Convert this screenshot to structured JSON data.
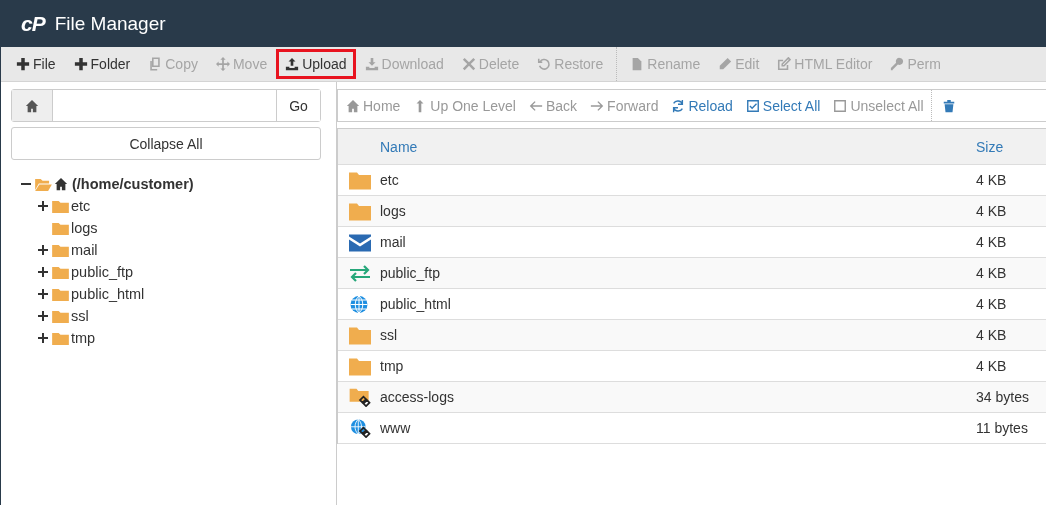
{
  "header": {
    "logo": "cP",
    "title": "File Manager"
  },
  "toolbar": [
    [
      {
        "label": "File",
        "kind": "plus",
        "disabled": false,
        "highlighted": false
      },
      {
        "label": "Folder",
        "kind": "plus",
        "disabled": false,
        "highlighted": false
      },
      {
        "label": "Copy",
        "kind": "copy",
        "disabled": true,
        "highlighted": false
      },
      {
        "label": "Move",
        "kind": "move",
        "disabled": true,
        "highlighted": false
      },
      {
        "label": "Upload",
        "kind": "upload",
        "disabled": false,
        "highlighted": true
      },
      {
        "label": "Download",
        "kind": "download",
        "disabled": true,
        "highlighted": false
      },
      {
        "label": "Delete",
        "kind": "delete",
        "disabled": true,
        "highlighted": false
      },
      {
        "label": "Restore",
        "kind": "restore",
        "disabled": true,
        "highlighted": false
      }
    ],
    [
      {
        "label": "Rename",
        "kind": "file",
        "disabled": true,
        "highlighted": false
      },
      {
        "label": "Edit",
        "kind": "pencil",
        "disabled": true,
        "highlighted": false
      },
      {
        "label": "HTML Editor",
        "kind": "htmledit",
        "disabled": true,
        "highlighted": false
      },
      {
        "label": "Perm",
        "kind": "key",
        "disabled": true,
        "highlighted": false
      }
    ]
  ],
  "path_bar": {
    "button": "Go"
  },
  "collapse_button": "Collapse All",
  "tree": {
    "label": "(/home/customer)",
    "expanded": true,
    "children": [
      {
        "label": "etc",
        "expandable": true
      },
      {
        "label": "logs",
        "expandable": false
      },
      {
        "label": "mail",
        "expandable": true
      },
      {
        "label": "public_ftp",
        "expandable": true
      },
      {
        "label": "public_html",
        "expandable": true
      },
      {
        "label": "ssl",
        "expandable": true
      },
      {
        "label": "tmp",
        "expandable": true
      }
    ]
  },
  "nav": [
    [
      {
        "label": "Home",
        "kind": "home",
        "disabled": true
      },
      {
        "label": "Up One Level",
        "kind": "up",
        "disabled": true
      },
      {
        "label": "Back",
        "kind": "back",
        "disabled": true
      },
      {
        "label": "Forward",
        "kind": "forward",
        "disabled": true
      },
      {
        "label": "Reload",
        "kind": "reload",
        "disabled": false
      },
      {
        "label": "Select All",
        "kind": "checked",
        "disabled": false
      },
      {
        "label": "Unselect All",
        "kind": "unchecked",
        "disabled": true
      }
    ],
    [
      {
        "kind": "trash",
        "disabled": false
      }
    ]
  ],
  "table": {
    "columns": [
      "Name",
      "Size"
    ],
    "rows": [
      {
        "kind": "folder",
        "name": "etc",
        "size": "4 KB"
      },
      {
        "kind": "folder",
        "name": "logs",
        "size": "4 KB"
      },
      {
        "kind": "mail",
        "name": "mail",
        "size": "4 KB"
      },
      {
        "kind": "ftp",
        "name": "public_ftp",
        "size": "4 KB"
      },
      {
        "kind": "globe",
        "name": "public_html",
        "size": "4 KB"
      },
      {
        "kind": "folder",
        "name": "ssl",
        "size": "4 KB"
      },
      {
        "kind": "folder",
        "name": "tmp",
        "size": "4 KB"
      },
      {
        "kind": "folder-link",
        "name": "access-logs",
        "size": "34 bytes"
      },
      {
        "kind": "globe-link",
        "name": "www",
        "size": "11 bytes"
      }
    ]
  }
}
